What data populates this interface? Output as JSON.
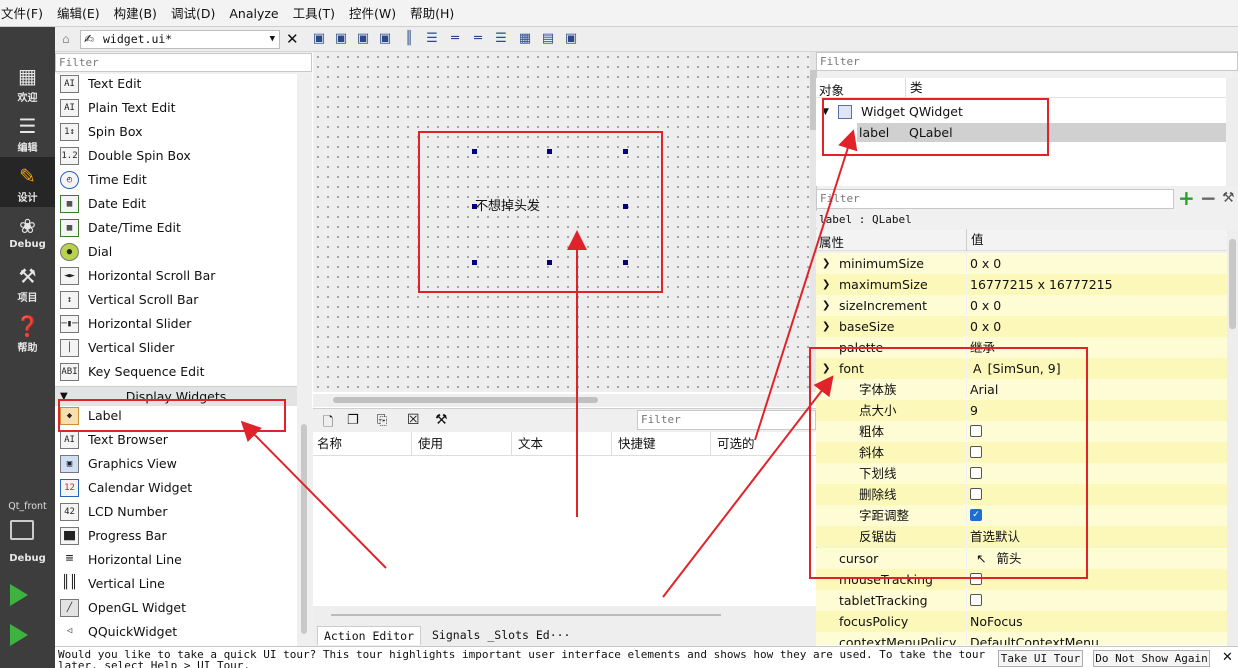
{
  "menubar": {
    "items": [
      "文件(F)",
      "编辑(E)",
      "构建(B)",
      "调试(D)",
      "Analyze",
      "工具(T)",
      "控件(W)",
      "帮助(H)"
    ]
  },
  "modebar": {
    "items": [
      {
        "label": "欢迎",
        "icon": "grid-icon"
      },
      {
        "label": "编辑",
        "icon": "document-icon"
      },
      {
        "label": "设计",
        "icon": "pencil-icon"
      },
      {
        "label": "Debug",
        "icon": "bug-icon"
      },
      {
        "label": "项目",
        "icon": "wrench-icon"
      },
      {
        "label": "帮助",
        "icon": "help-icon"
      }
    ],
    "project": "Qt_front",
    "target_label": "Debug"
  },
  "toolbar": {
    "file": "widget.ui*"
  },
  "widget_box": {
    "filter_placeholder": "Filter",
    "items": [
      "Text Edit",
      "Plain Text Edit",
      "Spin Box",
      "Double Spin Box",
      "Time Edit",
      "Date Edit",
      "Date/Time Edit",
      "Dial",
      "Horizontal Scroll Bar",
      "Vertical Scroll Bar",
      "Horizontal Slider",
      "Vertical Slider",
      "Key Sequence Edit"
    ],
    "group": "Display Widgets",
    "display_items": [
      "Label",
      "Text Browser",
      "Graphics View",
      "Calendar Widget",
      "LCD Number",
      "Progress Bar",
      "Horizontal Line",
      "Vertical Line",
      "OpenGL Widget",
      "QQuickWidget"
    ]
  },
  "canvas": {
    "label_text": "不想掉头发"
  },
  "action_editor": {
    "filter_placeholder": "Filter",
    "columns": [
      "名称",
      "使用",
      "文本",
      "快捷键",
      "可选的"
    ],
    "tabs": [
      "Action Editor",
      "Signals _Slots Ed···"
    ]
  },
  "object_inspector": {
    "filter_placeholder": "Filter",
    "col_object": "对象",
    "col_class": "类",
    "rows": [
      {
        "object": "Widget",
        "class": "QWidget"
      },
      {
        "object": "label",
        "class": "QLabel"
      }
    ]
  },
  "property_editor": {
    "filter_placeholder": "Filter",
    "current": "label : QLabel",
    "col_prop": "属性",
    "col_value": "值",
    "rows": [
      {
        "name": "minimumSize",
        "value": "0 x 0"
      },
      {
        "name": "maximumSize",
        "value": "16777215 x 16777215"
      },
      {
        "name": "sizeIncrement",
        "value": "0 x 0"
      },
      {
        "name": "baseSize",
        "value": "0 x 0"
      },
      {
        "name": "palette",
        "value": "继承"
      },
      {
        "name": "font",
        "value": "[SimSun, 9]"
      },
      {
        "name": "字体族",
        "value": "Arial"
      },
      {
        "name": "点大小",
        "value": "9"
      },
      {
        "name": "粗体",
        "value": ""
      },
      {
        "name": "斜体",
        "value": ""
      },
      {
        "name": "下划线",
        "value": ""
      },
      {
        "name": "删除线",
        "value": ""
      },
      {
        "name": "字距调整",
        "value": ""
      },
      {
        "name": "反锯齿",
        "value": "首选默认"
      },
      {
        "name": "cursor",
        "value": "箭头"
      },
      {
        "name": "mouseTracking",
        "value": ""
      },
      {
        "name": "tabletTracking",
        "value": ""
      },
      {
        "name": "focusPolicy",
        "value": "NoFocus"
      },
      {
        "name": "contextMenuPolicy",
        "value": "DefaultContextMenu"
      }
    ]
  },
  "status": {
    "message": "Would you like to take a quick UI tour? This tour highlights important user interface elements and shows how they are used. To take the tour later, select Help > UI Tour.",
    "take_tour": "Take UI Tour",
    "dont_show": "Do Not Show Again"
  }
}
